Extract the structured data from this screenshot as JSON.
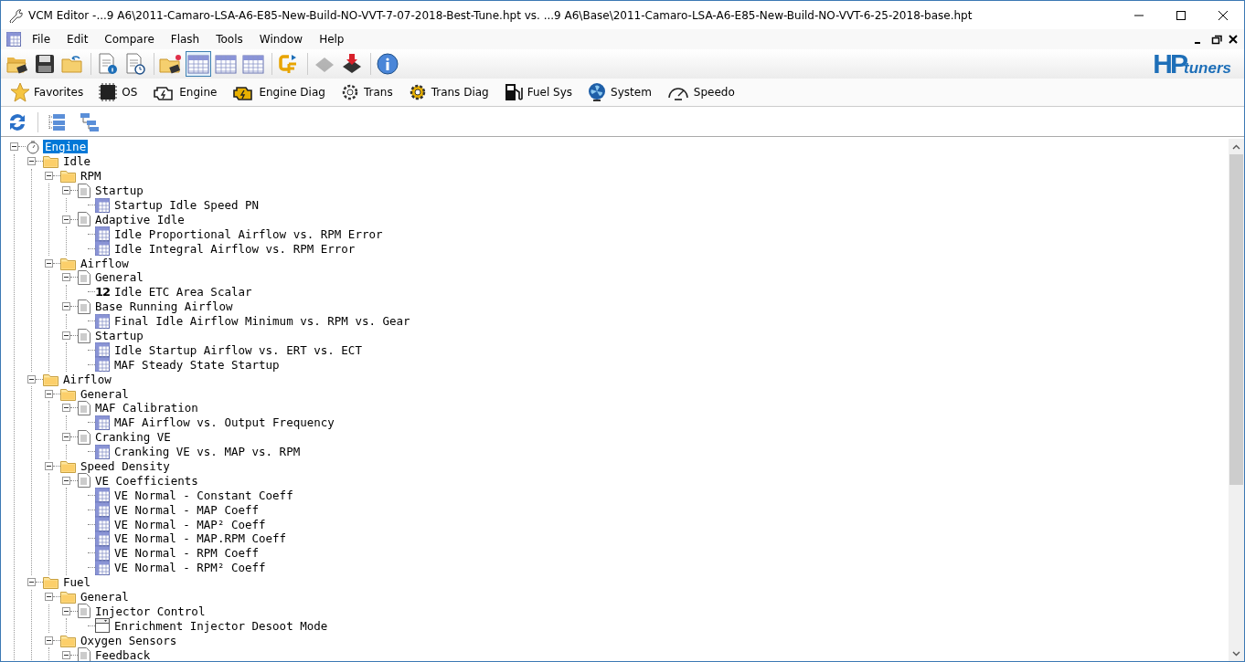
{
  "window": {
    "title": "VCM Editor -...9 A6\\2011-Camaro-LSA-A6-E85-New-Build-NO-VVT-7-07-2018-Best-Tune.hpt vs. ...9 A6\\Base\\2011-Camaro-LSA-A6-E85-New-Build-NO-VVT-6-25-2018-base.hpt"
  },
  "menu": [
    "File",
    "Edit",
    "Compare",
    "Flash",
    "Tools",
    "Window",
    "Help"
  ],
  "toolbar": [
    {
      "kind": "open",
      "disabled": false,
      "selected": false
    },
    {
      "kind": "save",
      "disabled": false,
      "selected": false
    },
    {
      "kind": "folder-back",
      "disabled": false,
      "selected": false
    },
    {
      "kind": "sep"
    },
    {
      "kind": "doc-info",
      "disabled": false,
      "selected": false
    },
    {
      "kind": "doc-clock",
      "disabled": false,
      "selected": false
    },
    {
      "kind": "sep"
    },
    {
      "kind": "folder-chip",
      "disabled": false,
      "selected": false
    },
    {
      "kind": "grid",
      "disabled": false,
      "selected": true
    },
    {
      "kind": "grid",
      "disabled": false,
      "selected": false
    },
    {
      "kind": "grid",
      "disabled": false,
      "selected": false
    },
    {
      "kind": "sep"
    },
    {
      "kind": "cf",
      "disabled": false,
      "selected": false
    },
    {
      "kind": "sep"
    },
    {
      "kind": "chip",
      "disabled": true,
      "selected": false
    },
    {
      "kind": "chip-down",
      "disabled": false,
      "selected": false
    },
    {
      "kind": "sep"
    },
    {
      "kind": "info",
      "disabled": false,
      "selected": false
    }
  ],
  "logo": {
    "hp": "HP",
    "tuners": "tuners"
  },
  "categories": [
    {
      "kind": "star",
      "label": "Favorites"
    },
    {
      "kind": "chip",
      "label": "OS"
    },
    {
      "kind": "engine",
      "label": "Engine"
    },
    {
      "kind": "engine-diag",
      "label": "Engine Diag"
    },
    {
      "kind": "gear",
      "label": "Trans"
    },
    {
      "kind": "gear-diag",
      "label": "Trans Diag"
    },
    {
      "kind": "fuel",
      "label": "Fuel Sys"
    },
    {
      "kind": "fan",
      "label": "System"
    },
    {
      "kind": "speedo",
      "label": "Speedo"
    }
  ],
  "tree": [
    {
      "kind": "root",
      "label": "Engine",
      "selected": true,
      "expanded": true,
      "children": [
        {
          "kind": "folder",
          "label": "Idle",
          "selected": false,
          "expanded": true,
          "children": [
            {
              "kind": "folder",
              "label": "RPM",
              "selected": false,
              "expanded": true,
              "children": [
                {
                  "kind": "page",
                  "label": "Startup",
                  "selected": false,
                  "expanded": true,
                  "children": [
                    {
                      "kind": "table",
                      "label": "Startup Idle Speed PN",
                      "selected": false
                    }
                  ]
                },
                {
                  "kind": "page",
                  "label": "Adaptive Idle",
                  "selected": false,
                  "expanded": true,
                  "children": [
                    {
                      "kind": "table",
                      "label": "Idle Proportional Airflow vs. RPM Error",
                      "selected": false
                    },
                    {
                      "kind": "table",
                      "label": "Idle Integral Airflow vs. RPM Error",
                      "selected": false
                    }
                  ]
                }
              ]
            },
            {
              "kind": "folder",
              "label": "Airflow",
              "selected": false,
              "expanded": true,
              "children": [
                {
                  "kind": "page",
                  "label": "General",
                  "selected": false,
                  "expanded": true,
                  "children": [
                    {
                      "kind": "scalar",
                      "icon_text": "12",
                      "label": "Idle ETC Area Scalar",
                      "selected": false
                    }
                  ]
                },
                {
                  "kind": "page",
                  "label": "Base Running Airflow",
                  "selected": false,
                  "expanded": true,
                  "children": [
                    {
                      "kind": "table",
                      "label": "Final Idle Airflow Minimum vs. RPM vs. Gear",
                      "selected": false
                    }
                  ]
                },
                {
                  "kind": "page",
                  "label": "Startup",
                  "selected": false,
                  "expanded": true,
                  "children": [
                    {
                      "kind": "table",
                      "label": "Idle Startup Airflow vs. ERT vs. ECT",
                      "selected": false
                    },
                    {
                      "kind": "table",
                      "label": "MAF Steady State Startup",
                      "selected": false
                    }
                  ]
                }
              ]
            }
          ]
        },
        {
          "kind": "folder",
          "label": "Airflow",
          "selected": false,
          "expanded": true,
          "children": [
            {
              "kind": "folder",
              "label": "General",
              "selected": false,
              "expanded": true,
              "children": [
                {
                  "kind": "page",
                  "label": "MAF Calibration",
                  "selected": false,
                  "expanded": true,
                  "children": [
                    {
                      "kind": "table",
                      "label": "MAF Airflow vs. Output Frequency",
                      "selected": false
                    }
                  ]
                },
                {
                  "kind": "page",
                  "label": "Cranking VE",
                  "selected": false,
                  "expanded": true,
                  "children": [
                    {
                      "kind": "table",
                      "label": "Cranking VE vs. MAP vs. RPM",
                      "selected": false
                    }
                  ]
                }
              ]
            },
            {
              "kind": "folder",
              "label": "Speed Density",
              "selected": false,
              "expanded": true,
              "children": [
                {
                  "kind": "page",
                  "label": "VE Coefficients",
                  "selected": false,
                  "expanded": true,
                  "children": [
                    {
                      "kind": "table",
                      "label": "VE Normal - Constant Coeff",
                      "selected": false
                    },
                    {
                      "kind": "table",
                      "label": "VE Normal - MAP Coeff",
                      "selected": false
                    },
                    {
                      "kind": "table",
                      "label": "VE Normal - MAP² Coeff",
                      "selected": false
                    },
                    {
                      "kind": "table",
                      "label": "VE Normal - MAP.RPM Coeff",
                      "selected": false
                    },
                    {
                      "kind": "table",
                      "label": "VE Normal - RPM Coeff",
                      "selected": false
                    },
                    {
                      "kind": "table",
                      "label": "VE Normal - RPM² Coeff",
                      "selected": false
                    }
                  ]
                }
              ]
            }
          ]
        },
        {
          "kind": "folder",
          "label": "Fuel",
          "selected": false,
          "expanded": true,
          "children": [
            {
              "kind": "folder",
              "label": "General",
              "selected": false,
              "expanded": true,
              "children": [
                {
                  "kind": "page",
                  "label": "Injector Control",
                  "selected": false,
                  "expanded": true,
                  "children": [
                    {
                      "kind": "switch",
                      "label": "Enrichment Injector Desoot Mode",
                      "selected": false
                    }
                  ]
                }
              ]
            },
            {
              "kind": "folder",
              "label": "Oxygen Sensors",
              "selected": false,
              "expanded": true,
              "children": [
                {
                  "kind": "page",
                  "label": "Feedback",
                  "selected": false,
                  "expanded": true
                }
              ]
            }
          ]
        }
      ]
    }
  ]
}
